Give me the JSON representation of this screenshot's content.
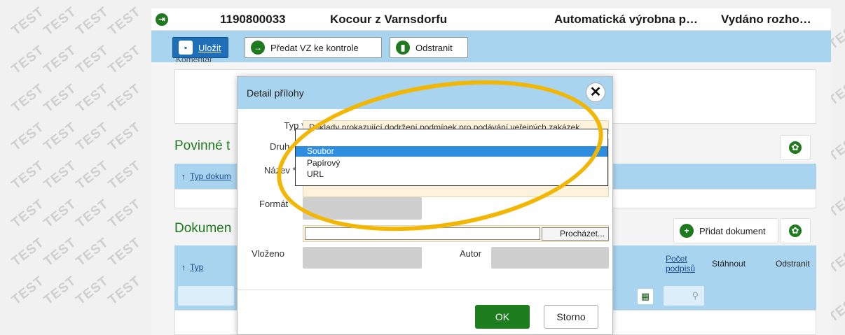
{
  "watermark": "TEST",
  "header": {
    "id": "1190800033",
    "name": "Kocour z Varnsdorfu",
    "type": "Automatická výrobna p…",
    "status": "Vydáno rozho…"
  },
  "toolbar": {
    "save_label": "Uložit",
    "handover_label": "Předat VZ ke kontrole",
    "delete_label": "Odstranit"
  },
  "comment_label": "Komentář",
  "required_section_title": "Povinné t",
  "required_table_header": "Typ dokum",
  "documents_section_title": "Dokumen",
  "add_document_label": "Přidat dokument",
  "documents_table": {
    "col_type": "Typ",
    "col_signatures_line1": "Počet",
    "col_signatures_line2": "podpisů",
    "col_download": "Stáhnout",
    "col_delete": "Odstranit"
  },
  "modal": {
    "title": "Detail přílohy",
    "labels": {
      "type": "Typ *",
      "kind": "Druh *",
      "name": "Název *",
      "format": "Formát *",
      "inserted": "Vloženo",
      "author": "Autor"
    },
    "type_value": "Doklady prokazující dodržení podmínek pro podávání veřejných zakázek",
    "browse_label": "Procházet...",
    "ok_label": "OK",
    "cancel_label": "Storno"
  },
  "dropdown": {
    "options": [
      "Soubor",
      "Papírový",
      "URL"
    ],
    "selected": "Soubor"
  },
  "colors": {
    "accent_blue": "#a8d4ef",
    "primary_green": "#1f7a1f",
    "highlight": "#f2b705",
    "selected_option": "#2f8ee0"
  }
}
